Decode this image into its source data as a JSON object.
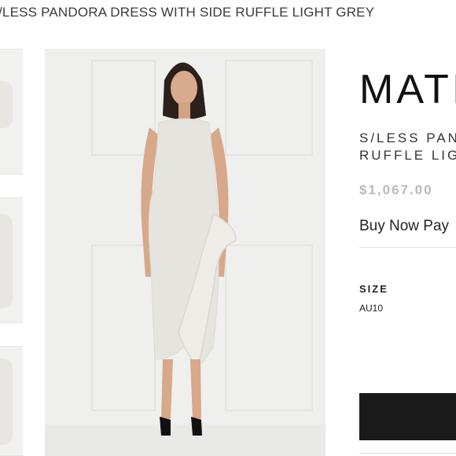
{
  "page": {
    "heading": "/LESS PANDORA DRESS WITH SIDE RUFFLE LIGHT GREY"
  },
  "gallery": {
    "thumbnails": [
      {
        "alt": "dress thumbnail 1"
      },
      {
        "alt": "dress thumbnail 2"
      },
      {
        "alt": "dress thumbnail 3"
      }
    ],
    "main_image_alt": "Model wearing light grey sleeveless dress with side ruffle"
  },
  "product": {
    "brand": "MATI",
    "name": "S/LESS PAN RUFFLE LIG",
    "price": "$1,067.00",
    "bnpl_text": "Buy Now Pay",
    "size_label": "SIZE",
    "size_value": "AU10"
  },
  "colors": {
    "background": "#ffffff",
    "image_bg": "#efefee",
    "dress": "#e6e4de",
    "price": "#b9b9b9",
    "button": "#1a1a1a"
  }
}
